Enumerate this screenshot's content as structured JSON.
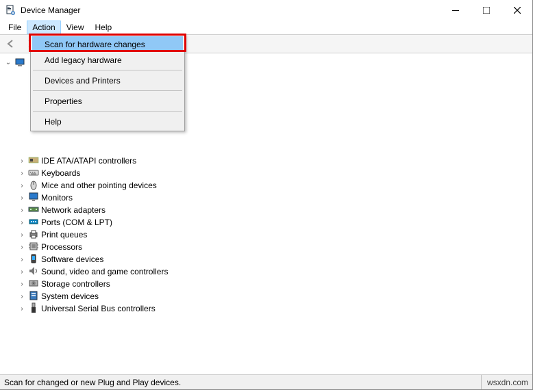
{
  "window": {
    "title": "Device Manager"
  },
  "menubar": {
    "items": [
      "File",
      "Action",
      "View",
      "Help"
    ],
    "open_index": 1
  },
  "action_menu": {
    "items": [
      {
        "label": "Scan for hardware changes",
        "highlighted": true
      },
      {
        "label": "Add legacy hardware"
      },
      {
        "sep": true
      },
      {
        "label": "Devices and Printers"
      },
      {
        "sep": true
      },
      {
        "label": "Properties"
      },
      {
        "sep": true
      },
      {
        "label": "Help"
      }
    ]
  },
  "tree": {
    "root_label": "",
    "children": [
      {
        "icon": "hidden",
        "label": ""
      },
      {
        "icon": "hidden",
        "label": ""
      },
      {
        "icon": "hidden",
        "label": ""
      },
      {
        "icon": "hidden",
        "label": ""
      },
      {
        "icon": "hidden",
        "label": ""
      },
      {
        "icon": "hidden",
        "label": ""
      },
      {
        "icon": "hidden",
        "label": ""
      },
      {
        "icon": "ide",
        "label": "IDE ATA/ATAPI controllers"
      },
      {
        "icon": "keyboard",
        "label": "Keyboards"
      },
      {
        "icon": "mouse",
        "label": "Mice and other pointing devices"
      },
      {
        "icon": "monitor",
        "label": "Monitors"
      },
      {
        "icon": "network",
        "label": "Network adapters"
      },
      {
        "icon": "port",
        "label": "Ports (COM & LPT)"
      },
      {
        "icon": "printer",
        "label": "Print queues"
      },
      {
        "icon": "cpu",
        "label": "Processors"
      },
      {
        "icon": "software",
        "label": "Software devices"
      },
      {
        "icon": "sound",
        "label": "Sound, video and game controllers"
      },
      {
        "icon": "storage",
        "label": "Storage controllers"
      },
      {
        "icon": "system",
        "label": "System devices"
      },
      {
        "icon": "usb",
        "label": "Universal Serial Bus controllers"
      }
    ]
  },
  "statusbar": {
    "text": "Scan for changed or new Plug and Play devices.",
    "right": "wsxdn.com"
  }
}
